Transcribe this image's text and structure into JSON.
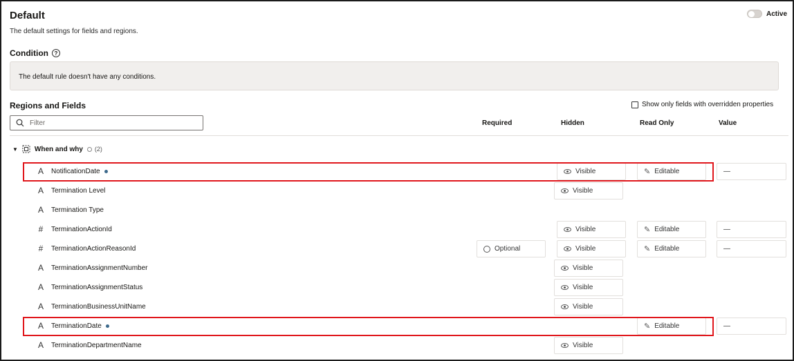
{
  "header": {
    "title": "Default",
    "subtitle": "The default settings for fields and regions.",
    "active_label": "Active"
  },
  "condition": {
    "title": "Condition",
    "help_glyph": "?",
    "message": "The default rule doesn't have any conditions."
  },
  "regions": {
    "title": "Regions and Fields",
    "override_label": "Show only fields with overridden properties",
    "filter_placeholder": "Filter",
    "columns": {
      "required": "Required",
      "hidden": "Hidden",
      "read_only": "Read Only",
      "value": "Value"
    }
  },
  "group": {
    "name": "When and why",
    "count": "(2)"
  },
  "rows": [
    {
      "icon": "A",
      "label": "NotificationDate",
      "hidden": "Visible",
      "read_only": "Editable",
      "value": "—"
    },
    {
      "icon": "A",
      "label": "Termination Level",
      "hidden": "Visible"
    },
    {
      "icon": "A",
      "label": "Termination Type"
    },
    {
      "icon": "#",
      "label": "TerminationActionId",
      "hidden": "Visible",
      "read_only": "Editable",
      "value": "—"
    },
    {
      "icon": "#",
      "label": "TerminationActionReasonId",
      "required": "Optional",
      "hidden": "Visible",
      "read_only": "Editable",
      "value": "—"
    },
    {
      "icon": "A",
      "label": "TerminationAssignmentNumber",
      "hidden": "Visible"
    },
    {
      "icon": "A",
      "label": "TerminationAssignmentStatus",
      "hidden": "Visible"
    },
    {
      "icon": "A",
      "label": "TerminationBusinessUnitName",
      "hidden": "Visible"
    },
    {
      "icon": "A",
      "label": "TerminationDate",
      "read_only": "Editable",
      "value": "—"
    },
    {
      "icon": "A",
      "label": "TerminationDepartmentName",
      "hidden": "Visible"
    }
  ],
  "colors": {
    "highlight": "#e0161b",
    "dot": "#3d6a8c"
  }
}
